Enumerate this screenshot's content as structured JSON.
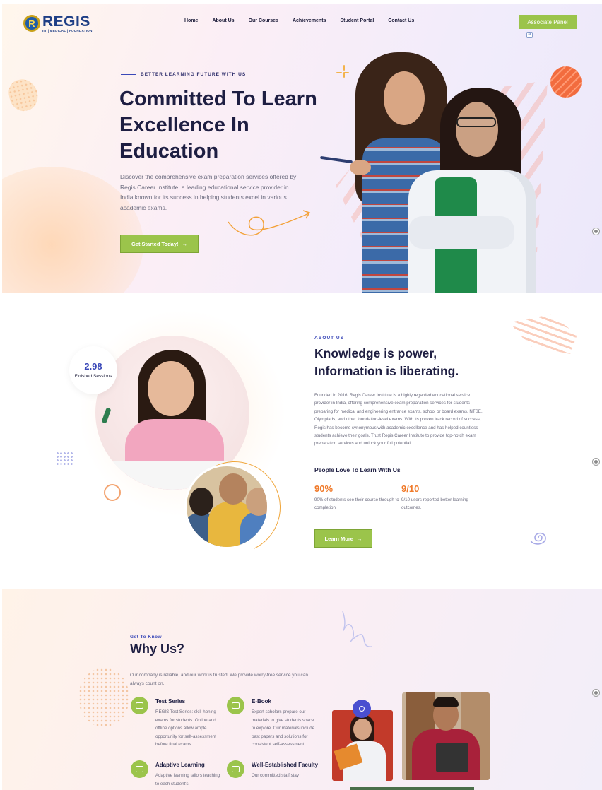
{
  "brand": {
    "logo_letter": "R",
    "name": "REGIS",
    "tagline": "IIT | MEDICAL | FOUNDATION"
  },
  "nav": {
    "items": [
      "Home",
      "About Us",
      "Our Courses",
      "Achievements",
      "Student Portal",
      "Contact Us"
    ],
    "associate_label": "Associate Panel"
  },
  "hero": {
    "eyebrow": "BETTER LEARNING FUTURE WITH US",
    "title": "Committed To Learn Excellence In Education",
    "description": "Discover the comprehensive exam preparation services offered by Regis Career Institute, a leading educational service provider in India known for its success in helping students excel in various academic exams.",
    "cta_label": "Get Started Today!",
    "cta_arrow": "→"
  },
  "about": {
    "eyebrow": "ABOUT US",
    "title": "Knowledge is power, Information is liberating.",
    "description": "Founded in 2016, Regis Career Institute is a highly regarded educational service provider in India, offering comprehensive exam preparation services for students preparing for medical and engineering entrance exams, school or board exams, NTSE, Olympiads, and other foundation-level exams. With its proven track record of success, Regis has become synonymous with academic excellence and has helped countless students achieve their goals. Trust Regis Career Institute to provide top-notch exam preparation services and unlock your full potential.",
    "stat_value": "2.98",
    "stat_label": "Finished Sessions",
    "subheading": "People Love To Learn With Us",
    "metrics": [
      {
        "value": "90%",
        "text": "90% of students see their course through to completion."
      },
      {
        "value": "9/10",
        "text": "9/10 users reported better learning outcomes."
      }
    ],
    "cta_label": "Learn More",
    "cta_arrow": "→"
  },
  "why": {
    "eyebrow": "Get To Know",
    "title": "Why Us?",
    "description": "Our company is reliable, and our work is trusted. We provide worry-free service you can always count on.",
    "features": [
      {
        "title": "Test Series",
        "text": "REGIS Test Series: skill-honing exams for students. Online and offline options allow ample opportunity for self-assessment before final exams.",
        "icon": "test-series-icon"
      },
      {
        "title": "E-Book",
        "text": "Expert scholars prepare our materials to give students space to explore. Our materials include past papers and solutions for consistent self-assessment.",
        "icon": "ebook-icon"
      },
      {
        "title": "Adaptive Learning",
        "text": "Adaptive learning tailors teaching to each student's",
        "icon": "adaptive-learning-icon"
      },
      {
        "title": "Well-Established Faculty",
        "text": "Our committed staff stay",
        "icon": "faculty-icon"
      }
    ]
  },
  "colors": {
    "accent_green": "#9bc44b",
    "brand_blue": "#3a48b8",
    "accent_orange": "#f07a2a",
    "heading_dark": "#1e1e42"
  }
}
